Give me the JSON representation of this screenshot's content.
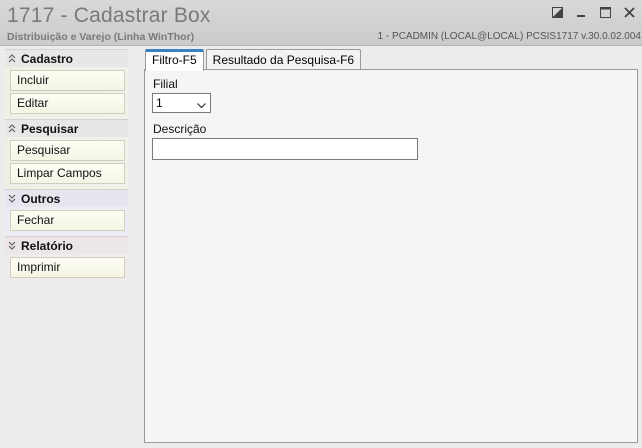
{
  "window": {
    "title": "1717 - Cadastrar Box",
    "subtitle": "Distribuição e Varejo (Linha WinThor)",
    "status_info": "1 - PCADMIN (LOCAL@LOCAL)   PCSIS1717  v.30.0.02.004"
  },
  "sidebar": {
    "groups": [
      {
        "title": "Cadastro",
        "items": [
          {
            "label": "Incluir"
          },
          {
            "label": "Editar"
          }
        ]
      },
      {
        "title": "Pesquisar",
        "items": [
          {
            "label": "Pesquisar"
          },
          {
            "label": "Limpar Campos"
          }
        ]
      },
      {
        "title": "Outros",
        "items": [
          {
            "label": "Fechar"
          }
        ]
      },
      {
        "title": "Relatório",
        "items": [
          {
            "label": "Imprimir"
          }
        ]
      }
    ]
  },
  "tabs": [
    {
      "label": "Filtro-F5",
      "active": true
    },
    {
      "label": "Resultado da Pesquisa-F6",
      "active": false
    }
  ],
  "form": {
    "filial_label": "Filial",
    "filial_value": "1",
    "descricao_label": "Descrição",
    "descricao_value": ""
  },
  "colors": {
    "active_tab_accent": "#3d7fc4",
    "titlebar": "#d0d0d0"
  },
  "icons": [
    "restore-icon",
    "minimize-icon",
    "maximize-icon",
    "close-icon",
    "chevron-down-icon"
  ]
}
